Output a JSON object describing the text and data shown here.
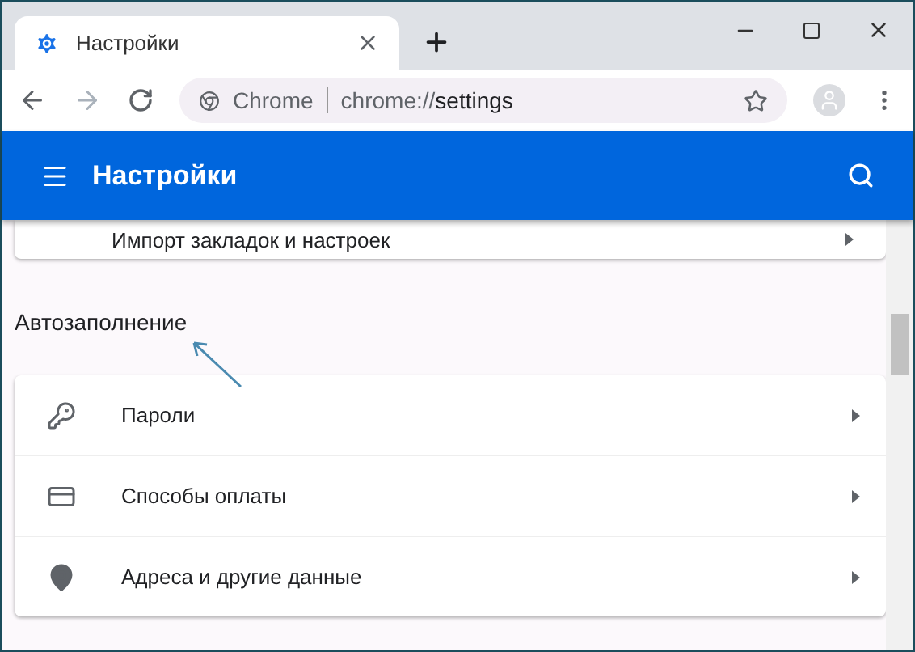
{
  "tab": {
    "title": "Настройки"
  },
  "omnibox": {
    "chip": "Chrome",
    "url_scheme": "chrome://",
    "url_path": "settings"
  },
  "header": {
    "title": "Настройки"
  },
  "previous_card": {
    "label": "Импорт закладок и настроек"
  },
  "section": {
    "title": "Автозаполнение"
  },
  "items": [
    {
      "label": "Пароли"
    },
    {
      "label": "Способы оплаты"
    },
    {
      "label": "Адреса и другие данные"
    }
  ]
}
